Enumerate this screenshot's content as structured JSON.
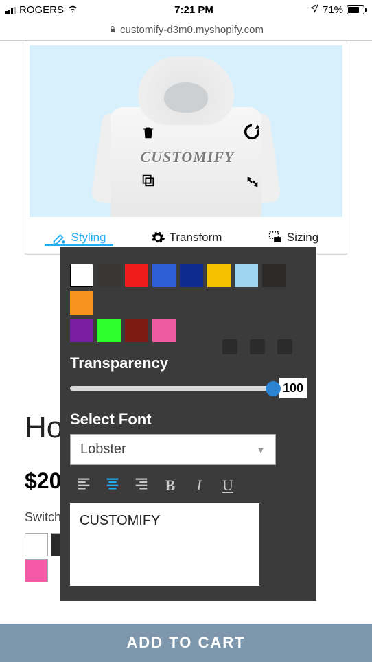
{
  "status_bar": {
    "carrier": "ROGERS",
    "time": "7:21 PM",
    "battery_pct": "71%"
  },
  "url_bar": {
    "host": "customify-d3m0.myshopify.com"
  },
  "designer": {
    "design_text": "CUSTOMIFY",
    "tabs": {
      "styling": "Styling",
      "transform": "Transform",
      "sizing": "Sizing"
    }
  },
  "styling_panel": {
    "colors_row1": [
      "#ffffff",
      "#3a3635",
      "#ef1b1b",
      "#2f5fd6",
      "#0c2a8f",
      "#f6bf00",
      "#9ed5f0",
      "#2c2a29",
      "#f7931e"
    ],
    "colors_row2": [
      "#7a1fa2",
      "#2dff2d",
      "#7d1a12",
      "#ef5ba1"
    ],
    "transparency_label": "Transparency",
    "transparency_value": "100",
    "select_font_label": "Select Font",
    "selected_font": "Lobster",
    "text_value": "CUSTOMIFY"
  },
  "product": {
    "title": "Hoodies",
    "price": "$20",
    "switch_label": "Switch",
    "swatches": [
      "#ffffff",
      "#2a2a2a",
      "#1a1a1a",
      "#1a1a1a",
      "#1a1a1a",
      "#1a1a1a",
      "#1a1a1a",
      "#1a1a1a",
      "#0f3f1a",
      "#6b0e0e"
    ],
    "swatches2": [
      "#f55aa8"
    ]
  },
  "cart": {
    "add_to_cart": "ADD TO CART"
  }
}
